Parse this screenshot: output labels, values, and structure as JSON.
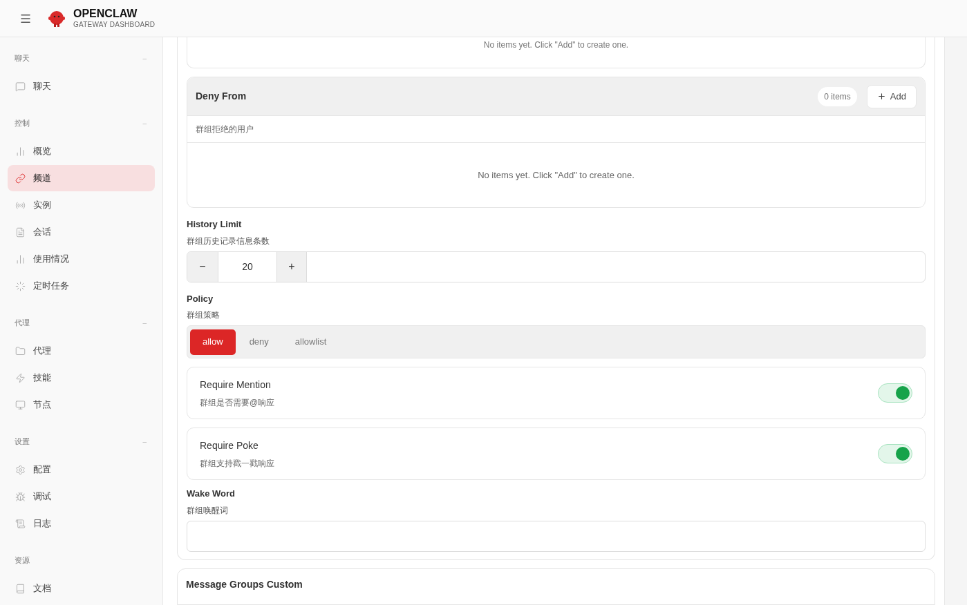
{
  "header": {
    "brand": "OPENCLAW",
    "subtitle": "GATEWAY DASHBOARD"
  },
  "sidebar": {
    "sections": [
      {
        "title": "聊天",
        "collapse": "–",
        "items": [
          {
            "label": "聊天",
            "selected": false
          }
        ]
      },
      {
        "title": "控制",
        "collapse": "–",
        "items": [
          {
            "label": "概览",
            "selected": false
          },
          {
            "label": "频道",
            "selected": true
          },
          {
            "label": "实例",
            "selected": false
          },
          {
            "label": "会话",
            "selected": false
          },
          {
            "label": "使用情况",
            "selected": false
          },
          {
            "label": "定时任务",
            "selected": false
          }
        ]
      },
      {
        "title": "代理",
        "collapse": "–",
        "items": [
          {
            "label": "代理",
            "selected": false
          },
          {
            "label": "技能",
            "selected": false
          },
          {
            "label": "节点",
            "selected": false
          }
        ]
      },
      {
        "title": "设置",
        "collapse": "–",
        "items": [
          {
            "label": "配置",
            "selected": false
          },
          {
            "label": "调试",
            "selected": false
          },
          {
            "label": "日志",
            "selected": false
          }
        ]
      },
      {
        "title": "资源",
        "items": [
          {
            "label": "文档",
            "selected": false
          }
        ]
      }
    ]
  },
  "previous_list": {
    "empty_text": "No items yet. Click \"Add\" to create one."
  },
  "deny_from": {
    "title": "Deny From",
    "count": "0 items",
    "add": "Add",
    "description": "群组拒绝的用户",
    "empty_text": "No items yet. Click \"Add\" to create one."
  },
  "history_limit": {
    "label": "History Limit",
    "description": "群组历史记录信息条数",
    "minus": "−",
    "value": "20",
    "plus": "+"
  },
  "policy": {
    "label": "Policy",
    "description": "群组策略",
    "options": [
      {
        "label": "allow",
        "selected": true
      },
      {
        "label": "deny",
        "selected": false
      },
      {
        "label": "allowlist",
        "selected": false
      }
    ]
  },
  "toggles": [
    {
      "label": "Require Mention",
      "description": "群组是否需要@响应",
      "on": true
    },
    {
      "label": "Require Poke",
      "description": "群组支持戳一戳响应",
      "on": true
    }
  ],
  "wake_word": {
    "label": "Wake Word",
    "description": "群组唤醒词"
  },
  "next_section": {
    "title": "Message Groups Custom"
  }
}
